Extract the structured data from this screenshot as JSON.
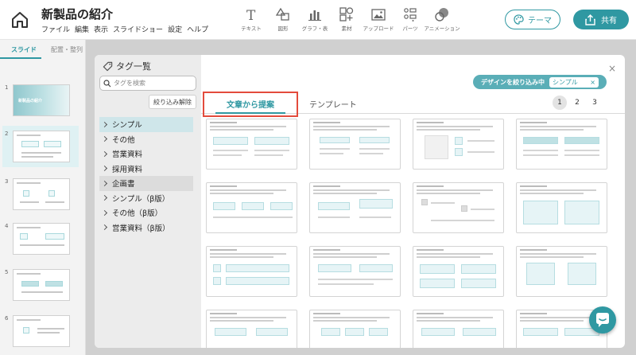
{
  "app": {
    "title": "新製品の紹介",
    "menu": [
      "ファイル",
      "編集",
      "表示",
      "スライドショー",
      "設定",
      "ヘルプ"
    ]
  },
  "toolbar": {
    "tools": [
      {
        "label": "テキスト",
        "icon": "text-icon"
      },
      {
        "label": "図形",
        "icon": "shapes-icon"
      },
      {
        "label": "グラフ・表",
        "icon": "bar-chart-icon"
      },
      {
        "label": "素材",
        "icon": "materials-icon"
      },
      {
        "label": "アップロード",
        "icon": "image-upload-icon"
      },
      {
        "label": "パーツ",
        "icon": "parts-icon"
      },
      {
        "label": "アニメーション",
        "icon": "animation-icon"
      }
    ],
    "theme_label": "テーマ",
    "share_label": "共有"
  },
  "left_panel": {
    "tabs": [
      "スライド",
      "配置・整列"
    ],
    "active_tab": "スライド",
    "slides": [
      {
        "number": "1",
        "title": "新製品の紹介"
      },
      {
        "number": "2"
      },
      {
        "number": "3"
      },
      {
        "number": "4"
      },
      {
        "number": "5"
      },
      {
        "number": "6"
      }
    ],
    "selected_slide": "2"
  },
  "modal": {
    "title": "タグ一覧",
    "search_placeholder": "タグを検索",
    "clear_filter_label": "絞り込み解除",
    "tags": [
      "シンプル",
      "その他",
      "営業資料",
      "採用資料",
      "企画書",
      "シンプル（β版）",
      "その他（β版）",
      "営業資料（β版）"
    ],
    "selected_tag": "シンプル",
    "highlighted_tag": "企画書",
    "filter_label": "デザインを絞り込み中",
    "filter_value": "シンプル",
    "tabs": [
      "文章から提案",
      "テンプレート"
    ],
    "active_tab": "文章から提案",
    "pages": [
      "1",
      "2",
      "3"
    ],
    "current_page": "1",
    "close_symbol": "×",
    "clear_symbol": "×"
  },
  "colors": {
    "accent": "#2f98a2",
    "highlight_border": "#e34b3c",
    "tag_selected": "#cfe6ea"
  }
}
